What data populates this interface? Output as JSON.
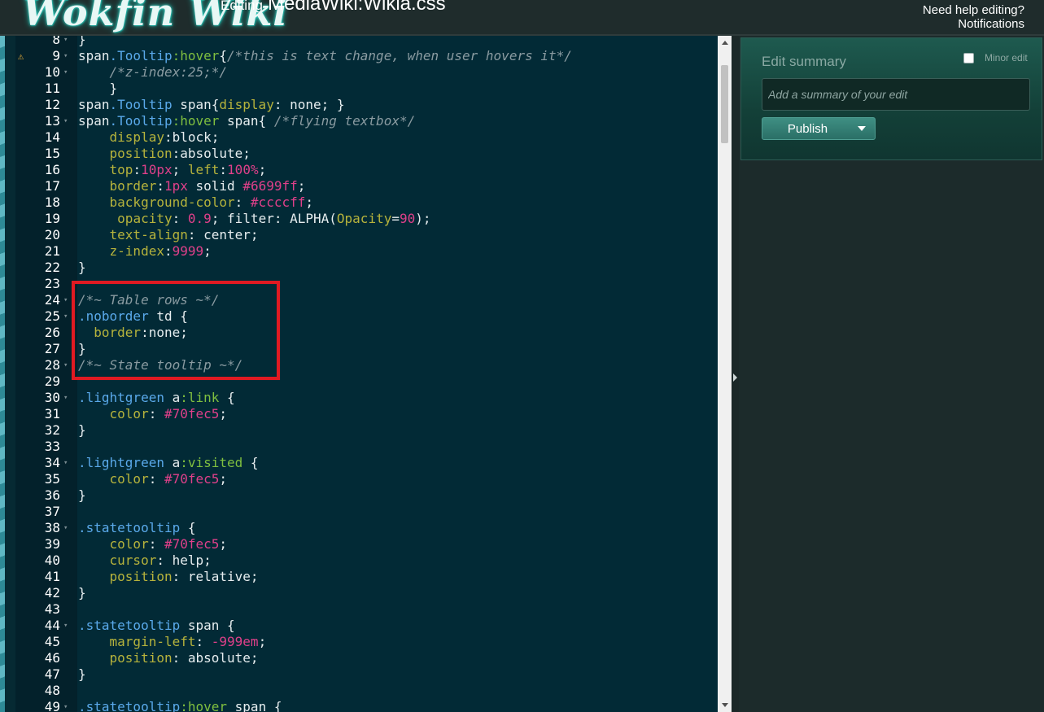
{
  "header": {
    "logo_text": "Wokfin Wiki",
    "editing_prefix": "Editing",
    "page_name": "MediaWiki:Wikia.css",
    "help_link": "Need help editing?",
    "notifications_link": "Notifications"
  },
  "editor": {
    "lines": [
      {
        "n": "8",
        "fold": true,
        "html": "<span class=\"c-txt\">}</span>"
      },
      {
        "n": "9",
        "fold": true,
        "warn": true,
        "html": "<span class=\"c-txt\">span</span><span class=\"c-sel\">.Tooltip</span><span class=\"c-ps\">:hover</span><span class=\"c-txt\">{</span><span class=\"c-com\">/*this is text change, when user hovers it*/</span>"
      },
      {
        "n": "10",
        "fold": true,
        "html": "    <span class=\"c-com\">/*z-index:25;*/</span>"
      },
      {
        "n": "11",
        "html": "    <span class=\"c-txt\">}</span>"
      },
      {
        "n": "12",
        "html": "<span class=\"c-txt\">span</span><span class=\"c-sel\">.Tooltip</span><span class=\"c-txt\"> span{</span><span class=\"c-prop\">display</span><span class=\"c-txt\">: none; }</span>"
      },
      {
        "n": "13",
        "fold": true,
        "html": "<span class=\"c-txt\">span</span><span class=\"c-sel\">.Tooltip</span><span class=\"c-ps\">:hover</span><span class=\"c-txt\"> span{ </span><span class=\"c-com\">/*flying textbox*/</span>"
      },
      {
        "n": "14",
        "html": "    <span class=\"c-prop\">display</span><span class=\"c-txt\">:block;</span>"
      },
      {
        "n": "15",
        "html": "    <span class=\"c-prop\">position</span><span class=\"c-txt\">:absolute;</span>"
      },
      {
        "n": "16",
        "html": "    <span class=\"c-prop\">top</span><span class=\"c-txt\">:</span><span class=\"c-num\">10px</span><span class=\"c-txt\">; </span><span class=\"c-prop\">left</span><span class=\"c-txt\">:</span><span class=\"c-num\">100%</span><span class=\"c-txt\">;</span>"
      },
      {
        "n": "17",
        "html": "    <span class=\"c-prop\">border</span><span class=\"c-txt\">:</span><span class=\"c-num\">1px</span><span class=\"c-txt\"> solid </span><span class=\"c-num\">#6699ff</span><span class=\"c-txt\">;</span>"
      },
      {
        "n": "18",
        "html": "    <span class=\"c-prop\">background-color</span><span class=\"c-txt\">: </span><span class=\"c-num\">#ccccff</span><span class=\"c-txt\">;</span>"
      },
      {
        "n": "19",
        "html": "     <span class=\"c-prop\">opacity</span><span class=\"c-txt\">: </span><span class=\"c-num\">0.9</span><span class=\"c-txt\">; filter: ALPHA(</span><span class=\"c-prop\">Opacity</span><span class=\"c-txt\">=</span><span class=\"c-num\">90</span><span class=\"c-txt\">);</span>"
      },
      {
        "n": "20",
        "html": "    <span class=\"c-prop\">text-align</span><span class=\"c-txt\">: center;</span>"
      },
      {
        "n": "21",
        "html": "    <span class=\"c-prop\">z-index</span><span class=\"c-txt\">:</span><span class=\"c-num\">9999</span><span class=\"c-txt\">;</span>"
      },
      {
        "n": "22",
        "html": "<span class=\"c-txt\">}</span>"
      },
      {
        "n": "23",
        "html": ""
      },
      {
        "n": "24",
        "fold": true,
        "html": "<span class=\"c-com\">/*~ Table rows ~*/</span>"
      },
      {
        "n": "25",
        "fold": true,
        "html": "<span class=\"c-sel\">.noborder</span><span class=\"c-txt\"> td {</span>"
      },
      {
        "n": "26",
        "html": "  <span class=\"c-prop\">border</span><span class=\"c-txt\">:none;</span>"
      },
      {
        "n": "27",
        "html": "<span class=\"c-txt\">}</span>"
      },
      {
        "n": "28",
        "fold": true,
        "html": "<span class=\"c-com\">/*~ State tooltip ~*/</span>"
      },
      {
        "n": "29",
        "html": ""
      },
      {
        "n": "30",
        "fold": true,
        "html": "<span class=\"c-sel\">.lightgreen</span><span class=\"c-txt\"> a</span><span class=\"c-ps\">:link</span><span class=\"c-txt\"> {</span>"
      },
      {
        "n": "31",
        "html": "    <span class=\"c-prop\">color</span><span class=\"c-txt\">: </span><span class=\"c-num\">#70fec5</span><span class=\"c-txt\">;</span>"
      },
      {
        "n": "32",
        "html": "<span class=\"c-txt\">}</span>"
      },
      {
        "n": "33",
        "html": ""
      },
      {
        "n": "34",
        "fold": true,
        "html": "<span class=\"c-sel\">.lightgreen</span><span class=\"c-txt\"> a</span><span class=\"c-ps\">:visited</span><span class=\"c-txt\"> {</span>"
      },
      {
        "n": "35",
        "html": "    <span class=\"c-prop\">color</span><span class=\"c-txt\">: </span><span class=\"c-num\">#70fec5</span><span class=\"c-txt\">;</span>"
      },
      {
        "n": "36",
        "html": "<span class=\"c-txt\">}</span>"
      },
      {
        "n": "37",
        "html": ""
      },
      {
        "n": "38",
        "fold": true,
        "html": "<span class=\"c-sel\">.statetooltip</span><span class=\"c-txt\"> {</span>"
      },
      {
        "n": "39",
        "html": "    <span class=\"c-prop\">color</span><span class=\"c-txt\">: </span><span class=\"c-num\">#70fec5</span><span class=\"c-txt\">;</span>"
      },
      {
        "n": "40",
        "html": "    <span class=\"c-prop\">cursor</span><span class=\"c-txt\">: help;</span>"
      },
      {
        "n": "41",
        "html": "    <span class=\"c-prop\">position</span><span class=\"c-txt\">: relative;</span>"
      },
      {
        "n": "42",
        "html": "<span class=\"c-txt\">}</span>"
      },
      {
        "n": "43",
        "html": ""
      },
      {
        "n": "44",
        "fold": true,
        "html": "<span class=\"c-sel\">.statetooltip</span><span class=\"c-txt\"> span {</span>"
      },
      {
        "n": "45",
        "html": "    <span class=\"c-prop\">margin-left</span><span class=\"c-txt\">: </span><span class=\"c-num\">-999em</span><span class=\"c-txt\">;</span>"
      },
      {
        "n": "46",
        "html": "    <span class=\"c-prop\">position</span><span class=\"c-txt\">: absolute;</span>"
      },
      {
        "n": "47",
        "html": "<span class=\"c-txt\">}</span>"
      },
      {
        "n": "48",
        "html": ""
      },
      {
        "n": "49",
        "fold": true,
        "html": "<span class=\"c-sel\">.statetooltip</span><span class=\"c-ps\">:hover</span><span class=\"c-txt\"> span {</span>"
      }
    ]
  },
  "summary_panel": {
    "title": "Edit summary",
    "minor_edit_label": "Minor edit",
    "minor_edit_checked": false,
    "input_placeholder": "Add a summary of your edit",
    "input_value": "",
    "publish_label": "Publish"
  },
  "colors": {
    "editor_background": "#022a36",
    "selector": "#5aa9ea",
    "pseudo": "#7fbf3f",
    "property": "#b6b33c",
    "number": "#e0408a",
    "comment": "#8a9ba1",
    "highlight_box": "#e01a22",
    "publish_button": "#2f7a70"
  },
  "icons": {
    "warning": "warning-icon",
    "fold": "fold-arrow-icon",
    "publish_dropdown": "chevron-down-icon",
    "splitter": "chevron-right-icon"
  }
}
